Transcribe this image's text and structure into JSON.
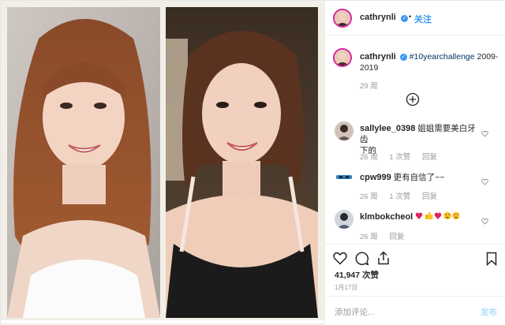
{
  "author": {
    "username": "cathrynli",
    "follow_label": "关注",
    "verified_mark": "✓"
  },
  "caption": {
    "hashtag": "#10yearchallenge",
    "text_rest": " 2009-",
    "text_line2": "2019",
    "time": "29 周"
  },
  "comments": [
    {
      "username": "sallylee_0398",
      "text_line1": "姐姐需要美白牙齿",
      "text_line2": "下的",
      "time": "26 周",
      "likes": "1 次赞",
      "reply": "回复"
    },
    {
      "username": "cpw999",
      "text_line1": "更有自信了~~",
      "text_line2": "",
      "time": "26 周",
      "likes": "1 次赞",
      "reply": "回复"
    },
    {
      "username": "klmbokcheol",
      "text_line1": "",
      "text_line2": "",
      "time": "26 周",
      "likes": "",
      "reply": "回复"
    }
  ],
  "likes_count": "41,947 次赞",
  "post_date": "1月17日",
  "add_comment_placeholder": "添加评论...",
  "post_button": "发布",
  "icons": [
    "heart-icon",
    "comment-icon",
    "share-icon",
    "bookmark-icon",
    "plus-circle-icon",
    "verified-icon"
  ],
  "colors": {
    "link": "#3897f0",
    "hashtag": "#003569",
    "text": "#262626",
    "muted": "#999999"
  }
}
